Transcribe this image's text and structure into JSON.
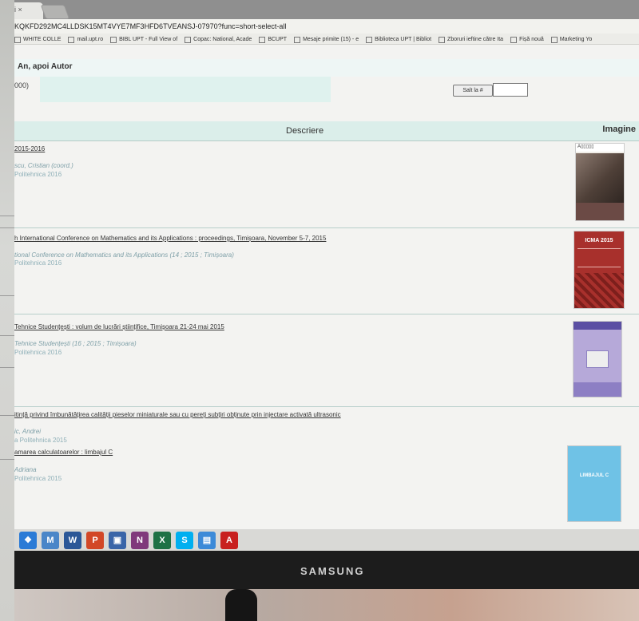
{
  "browser": {
    "tab_title": "Bi ×",
    "address": "KQKFD292MC4LLDSK15MT4VYE7MF3HFD6TVEANSJ-07970?func=short-select-all",
    "bookmarks": [
      {
        "label": "WHITE COLLE",
        "icon": "bookmark-icon"
      },
      {
        "label": "mail.upt.ro",
        "icon": "page-icon"
      },
      {
        "label": "BIBL UPT - Full View of",
        "icon": "page-icon"
      },
      {
        "label": "Copac: National, Acade",
        "icon": "star-icon"
      },
      {
        "label": "BCUPT",
        "icon": "bcupt-icon"
      },
      {
        "label": "Mesaje primite (15) - e",
        "icon": "gmail-icon"
      },
      {
        "label": "Biblioteca UPT | Bibliot",
        "icon": "page-icon"
      },
      {
        "label": "Zboruri ieftine către Ita",
        "icon": "flight-icon"
      },
      {
        "label": "Fișă nouă",
        "icon": "page-icon"
      },
      {
        "label": "Marketing Yo",
        "icon": "linkedin-icon"
      }
    ]
  },
  "page": {
    "sort_label": "An, apoi Autor",
    "total_label": "000)",
    "goto_label": "Salt la #",
    "col_description": "Descriere",
    "col_image": "Imagine"
  },
  "records": [
    {
      "title": "2015-2016",
      "author": "scu, Cristian (coord.)",
      "publisher": "Politehnica 2016"
    },
    {
      "title": "h International Conference on Mathematics and its Applications : proceedings, Timișoara, November 5-7, 2015",
      "author": "tional Conference on Mathematics and its Applications (14 ; 2015 ; Timișoara)",
      "publisher": "Politehnica 2016"
    },
    {
      "title": "Tehnice Studențești : volum de lucrări științifice, Timișoara 21-24 mai 2015",
      "author": "Tehnice Studențești (16 ; 2015 ; Timișoara)",
      "publisher": "Politehnica 2016"
    },
    {
      "title": "itință privind îmbunătățirea calității pieselor miniaturale sau cu pereți subțiri obținute prin injectare activată ultrasonic",
      "author": "ic, Andrei",
      "publisher": "a Politehnica 2015"
    },
    {
      "title": "amarea calculatoarelor : limbajul C",
      "author": "Adriana",
      "publisher": "Politehnica 2015"
    }
  ],
  "covers": [
    {
      "text": "",
      "color": "#5a4840"
    },
    {
      "text": "ICMA 2015",
      "color": "#a8302c"
    },
    {
      "text": "",
      "color": "#b6a9d9"
    },
    {
      "text": "LIMBAJUL C",
      "color": "#6fc2e6"
    }
  ],
  "taskbar": [
    {
      "name": "start-icon",
      "color": "#2b7bd6",
      "glyph": "❖"
    },
    {
      "name": "marc-icon",
      "color": "#4a86c8",
      "glyph": "M"
    },
    {
      "name": "word-icon",
      "color": "#2b5797",
      "glyph": "W"
    },
    {
      "name": "powerpoint-icon",
      "color": "#d24726",
      "glyph": "P"
    },
    {
      "name": "save-icon",
      "color": "#3a65a8",
      "glyph": "▣"
    },
    {
      "name": "onenote-icon",
      "color": "#80397b",
      "glyph": "N"
    },
    {
      "name": "excel-icon",
      "color": "#1e7145",
      "glyph": "X"
    },
    {
      "name": "skype-icon",
      "color": "#00aff0",
      "glyph": "S"
    },
    {
      "name": "picture-viewer-icon",
      "color": "#3c8ad8",
      "glyph": "▤"
    },
    {
      "name": "acrobat-icon",
      "color": "#c8201f",
      "glyph": "A"
    }
  ],
  "monitor": {
    "brand": "SAMSUNG"
  }
}
